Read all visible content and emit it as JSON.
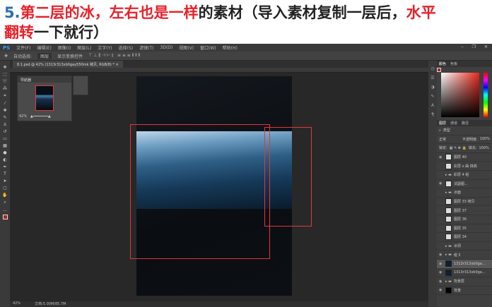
{
  "title": {
    "num": "5.",
    "red1": "第二层的冰，左右也是一样",
    "black1": "的素材（导入素材复制一层后，",
    "red2": "水平",
    "red3": "翻转",
    "black2": "一下就行）"
  },
  "menu": [
    "PS",
    "文件(F)",
    "编辑(E)",
    "图像(I)",
    "图层(L)",
    "文字(Y)",
    "选择(S)",
    "滤镜(T)",
    "3D(D)",
    "视图(V)",
    "窗口(W)",
    "帮助(H)"
  ],
  "options": {
    "auto_select": "自动选择:",
    "target": "图层",
    "transform": "显示变换控件"
  },
  "doc_tab": "8.1.psd @ 42% (1313r313xb0gay550mk 拷贝, RGB/8) * ×",
  "navigator": {
    "title": "导航器",
    "zoom": "42%"
  },
  "status": {
    "zoom": "42%",
    "doc": "文档:5.00M/85.7M"
  },
  "panels": {
    "color_tabs": [
      "颜色",
      "色板"
    ],
    "layer_tabs": [
      "图层",
      "通道",
      "路径"
    ],
    "kind": "类型",
    "blend": "正常",
    "opacity_label": "不透明度:",
    "opacity": "100%",
    "lock": "锁定:",
    "fill_label": "填充:",
    "fill": "100%"
  },
  "layers": [
    {
      "name": "图层 40",
      "eye": true,
      "thumb": "light"
    },
    {
      "name": "彩层 x 曲 抹高",
      "eye": false,
      "thumb": "light"
    },
    {
      "name": "彩层 4 组",
      "eye": false,
      "thumb": "folder"
    },
    {
      "name": "法副图...",
      "eye": true,
      "thumb": "light"
    },
    {
      "name": "冰面",
      "eye": false,
      "thumb": "folder"
    },
    {
      "name": "图层 33 拷贝",
      "eye": false,
      "thumb": "light"
    },
    {
      "name": "图层 37",
      "eye": false,
      "thumb": "light"
    },
    {
      "name": "图层 36",
      "eye": false,
      "thumb": "light"
    },
    {
      "name": "图层 35",
      "eye": false,
      "thumb": "light"
    },
    {
      "name": "图层 34",
      "eye": false,
      "thumb": "light"
    },
    {
      "name": "冰洞",
      "eye": false,
      "thumb": "folder"
    },
    {
      "name": "组 5",
      "eye": true,
      "thumb": "folder"
    },
    {
      "name": "1313r313xb0ga...",
      "eye": true,
      "thumb": "dark",
      "selected": true
    },
    {
      "name": "1313r313xb0ga...",
      "eye": true,
      "thumb": "dark"
    },
    {
      "name": "背景层",
      "eye": true,
      "thumb": "folder"
    },
    {
      "name": "背景",
      "eye": true,
      "thumb": "black"
    }
  ]
}
